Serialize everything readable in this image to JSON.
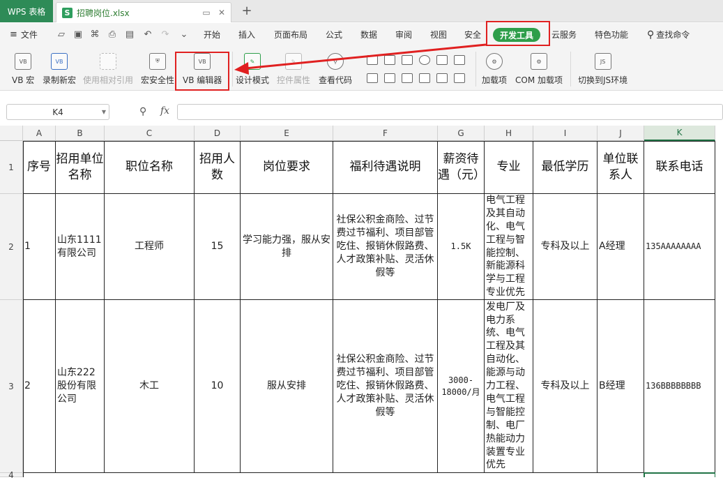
{
  "titlebar": {
    "app_tab": "WPS 表格",
    "file_tab": "招聘岗位.xlsx",
    "new_tab": "+"
  },
  "menubar": {
    "file_menu": "文件",
    "tabs": [
      "开始",
      "插入",
      "页面布局",
      "公式",
      "数据",
      "审阅",
      "视图",
      "安全",
      "开发工具",
      "云服务",
      "特色功能"
    ],
    "search": "查找命令"
  },
  "ribbon": {
    "vb_macro": "VB 宏",
    "record_macro": "录制新宏",
    "relative_ref": "使用相对引用",
    "macro_security": "宏安全性",
    "vb_editor": "VB 编辑器",
    "design_mode": "设计模式",
    "control_props": "控件属性",
    "view_code": "查看代码",
    "addins": "加载项",
    "com_addins": "COM 加载项",
    "js_env": "切换到JS环境"
  },
  "formulabar": {
    "namebox": "K4",
    "fx": "fx"
  },
  "sheet": {
    "columns": [
      "A",
      "B",
      "C",
      "D",
      "E",
      "F",
      "G",
      "H",
      "I",
      "J",
      "K"
    ],
    "rows": [
      "1",
      "2",
      "3",
      "4"
    ],
    "header": [
      "序号",
      "招用单位名称",
      "职位名称",
      "招用人数",
      "岗位要求",
      "福利待遇说明",
      "薪资待遇（元）",
      "专业",
      "最低学历",
      "单位联系人",
      "联系电话"
    ],
    "row2": [
      "1",
      "山东1111有限公司",
      "工程师",
      "15",
      "学习能力强，服从安排",
      "社保公积金商险、过节费过节福利、项目部管吃住、报销休假路费、人才政策补贴、灵活休假等",
      "1.5K",
      "电气工程及其自动化、电气工程与智能控制、新能源科学与工程专业优先",
      "专科及以上",
      "A经理",
      "135AAAAAAAA"
    ],
    "row3": [
      "2",
      "山东222股份有限公司",
      "木工",
      "10",
      "服从安排",
      "社保公积金商险、过节费过节福利、项目部管吃住、报销休假路费、人才政策补贴、灵活休假等",
      "3000-18000/月",
      "发电厂及电力系统、电气工程及其自动化、能源与动力工程、电气工程与智能控制、电厂热能动力装置专业优先",
      "专科及以上",
      "B经理",
      "136BBBBBBBB"
    ]
  },
  "colors": {
    "app_green": "#2e8b57",
    "dev_tab_green": "#2e9e4a",
    "highlight_red": "#e02020",
    "selection_green": "#217346"
  }
}
